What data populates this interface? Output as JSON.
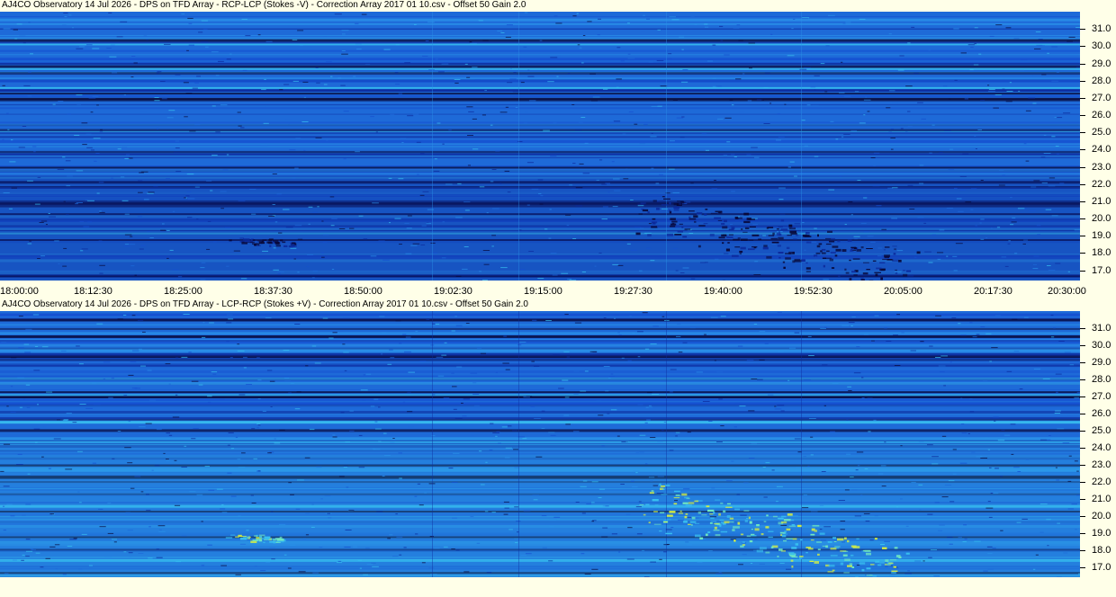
{
  "chart_data": [
    {
      "type": "heatmap",
      "title": "AJ4CO Observatory 14 Jul 2026  -  DPS on TFD Array  -  RCP-LCP (Stokes -V)  -  Correction Array 2017 01 10.csv  -  Offset 50  Gain 2.0",
      "xlabel": "",
      "ylabel": "",
      "x_range": [
        "18:00:00",
        "20:30:00"
      ],
      "x_ticks": [
        "18:00:00",
        "18:12:30",
        "18:25:00",
        "18:37:30",
        "18:50:00",
        "19:02:30",
        "19:15:00",
        "19:27:30",
        "19:40:00",
        "19:52:30",
        "20:05:00",
        "20:17:30",
        "20:30:00"
      ],
      "y_range": [
        16.4,
        32.0
      ],
      "y_ticks": [
        "31.0",
        "30.0",
        "29.0",
        "28.0",
        "27.0",
        "26.0",
        "25.0",
        "24.0",
        "23.0",
        "22.0",
        "21.0",
        "20.0",
        "19.0",
        "18.0",
        "17.0"
      ],
      "colormap": [
        "#08083a",
        "#0c2a9c",
        "#1550d0",
        "#1e6ad8",
        "#2a90e8",
        "#38c0f0",
        "#70e8c0",
        "#d8f040"
      ],
      "features": {
        "polarity": "negative",
        "bursts": [
          {
            "start": "19:30:00",
            "end": "20:05:00",
            "freq_high": 21.5,
            "freq_low": 16.8
          },
          {
            "start": "18:33:00",
            "end": "18:39:00",
            "freq_high": 19.0,
            "freq_low": 18.5
          }
        ]
      }
    },
    {
      "type": "heatmap",
      "title": "AJ4CO Observatory 14 Jul 2026  -  DPS on TFD Array  -  LCP-RCP (Stokes +V)  -  Correction Array 2017 01 10.csv  -  Offset 50  Gain 2.0",
      "xlabel": "",
      "ylabel": "",
      "x_range": [
        "18:00:00",
        "20:30:00"
      ],
      "y_range": [
        16.4,
        32.0
      ],
      "y_ticks": [
        "31.0",
        "30.0",
        "29.0",
        "28.0",
        "27.0",
        "26.0",
        "25.0",
        "24.0",
        "23.0",
        "22.0",
        "21.0",
        "20.0",
        "19.0",
        "18.0",
        "17.0"
      ],
      "colormap": [
        "#08083a",
        "#0c2a9c",
        "#1550d0",
        "#1e6ad8",
        "#2a90e8",
        "#38c0f0",
        "#70e8c0",
        "#d8f040"
      ],
      "features": {
        "polarity": "positive",
        "bursts": [
          {
            "start": "19:30:00",
            "end": "20:05:00",
            "freq_high": 22.0,
            "freq_low": 16.8
          },
          {
            "start": "18:33:00",
            "end": "18:39:00",
            "freq_high": 19.0,
            "freq_low": 18.5
          }
        ]
      }
    }
  ]
}
